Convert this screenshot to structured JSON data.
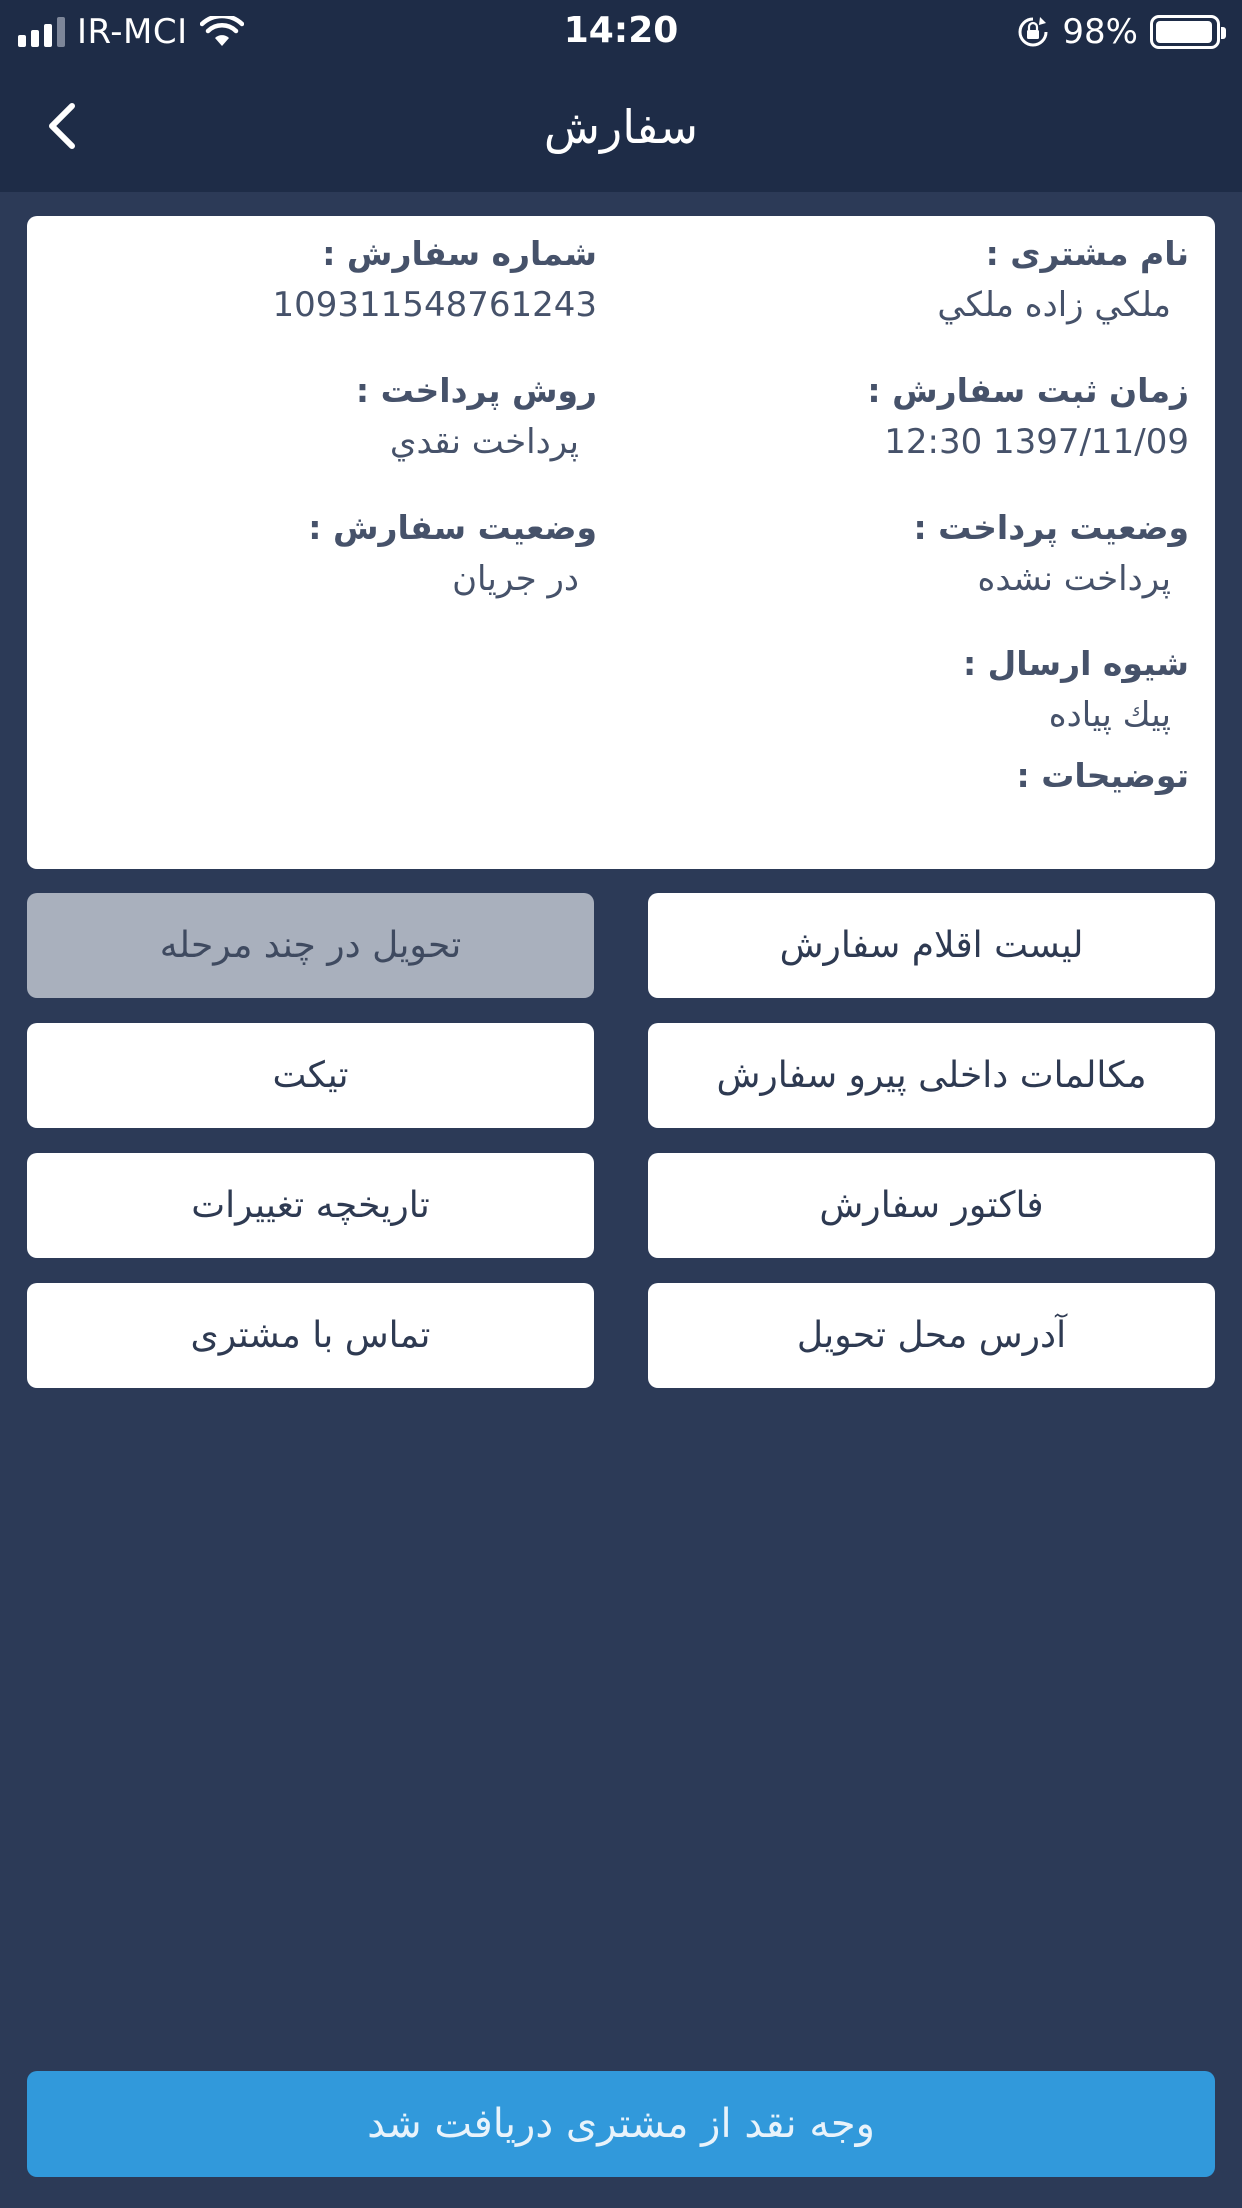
{
  "status_bar": {
    "carrier": "IR-MCI",
    "time": "14:20",
    "battery": "98%"
  },
  "nav": {
    "title": "سفارش"
  },
  "order_info": {
    "customer_name_label": "نام مشتری :",
    "customer_name": "ملكي زاده ملكي",
    "order_number_label": "شماره سفارش :",
    "order_number": "109311548761243",
    "order_time_label": "زمان ثبت سفارش :",
    "order_time": "12:30 1397/11/09",
    "payment_method_label": "روش پرداخت :",
    "payment_method": "پرداخت نقدي",
    "payment_status_label": "وضعیت پرداخت :",
    "payment_status": "پرداخت نشده",
    "order_status_label": "وضعیت سفارش :",
    "order_status": "در جريان",
    "shipping_method_label": "شیوه ارسال :",
    "shipping_method": "پیك پیاده",
    "notes_label": "توضیحات :"
  },
  "actions": {
    "order_items": "لیست اقلام سفارش",
    "multi_stage_delivery": "تحویل در چند مرحله",
    "internal_messages": "مکالمات داخلی پیرو سفارش",
    "ticket": "تیکت",
    "invoice": "فاکتور سفارش",
    "change_history": "تاریخچه تغییرات",
    "delivery_address": "آدرس محل تحویل",
    "contact_customer": "تماس با مشتری"
  },
  "cta": {
    "label": "وجه نقد از مشتری دریافت شد"
  },
  "colors": {
    "background": "#2c3a57",
    "header": "#1e2c47",
    "card": "#ffffff",
    "disabled_button": "#a9b0bd",
    "primary": "#3199db"
  }
}
